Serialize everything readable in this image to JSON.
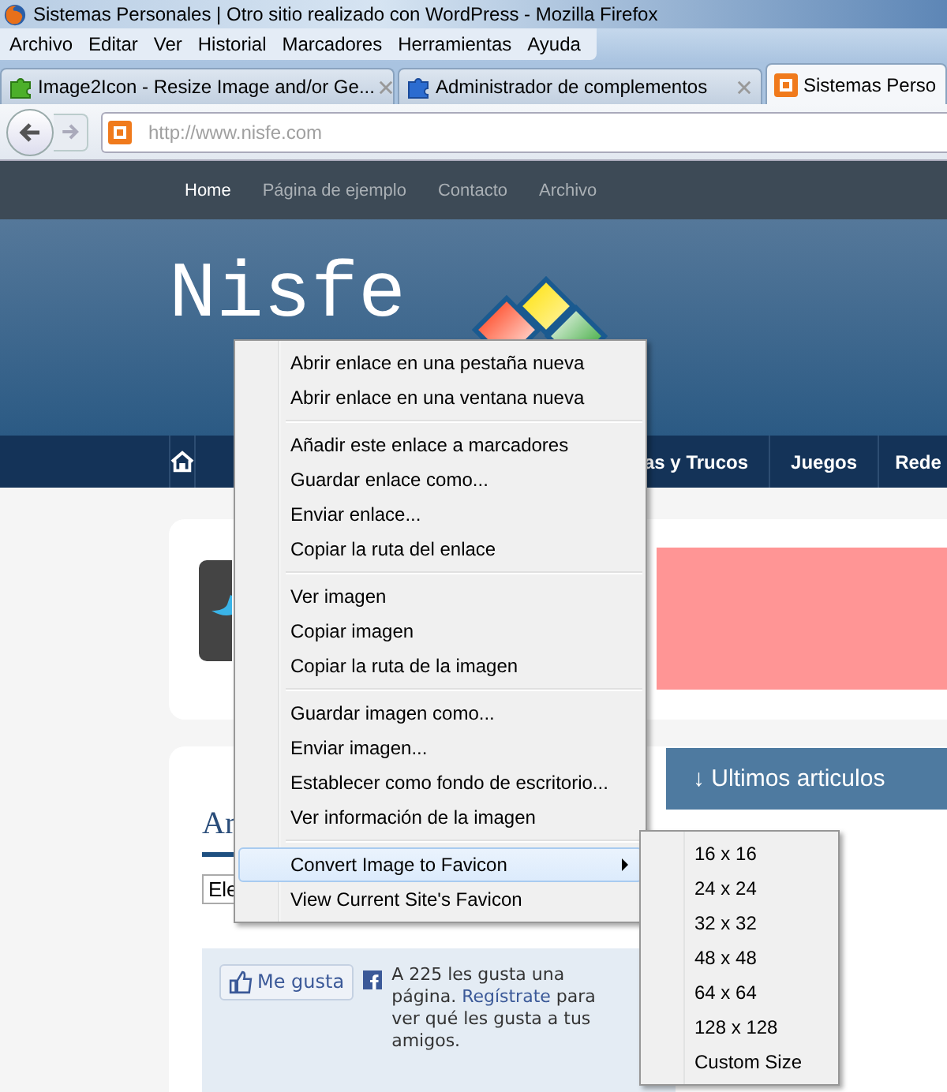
{
  "window": {
    "title": "Sistemas Personales | Otro sitio realizado con WordPress - Mozilla Firefox"
  },
  "menu_bar": [
    "Archivo",
    "Editar",
    "Ver",
    "Historial",
    "Marcadores",
    "Herramientas",
    "Ayuda"
  ],
  "tabs": [
    {
      "title": "Image2Icon - Resize Image and/or Ge...",
      "kind": "addon-green",
      "selected": false,
      "closable": true
    },
    {
      "title": "Administrador de complementos",
      "kind": "addon-blue",
      "selected": false,
      "closable": true
    },
    {
      "title": "Sistemas Perso",
      "kind": "site",
      "selected": true,
      "closable": false
    }
  ],
  "address_bar": {
    "value": "http://www.nisfe.com"
  },
  "site": {
    "top_nav": [
      {
        "label": "Home",
        "selected": true
      },
      {
        "label": "Página de ejemplo",
        "selected": false
      },
      {
        "label": "Contacto",
        "selected": false
      },
      {
        "label": "Archivo",
        "selected": false
      }
    ],
    "logo_text": "Nisfe",
    "main_nav": [
      "as y Trucos",
      "Juegos",
      "Rede"
    ],
    "section_heading": "↓ Ultimos articulos",
    "archive_heading": "Ar",
    "select_value": "Ele",
    "facebook": {
      "like_button": "Me gusta",
      "text_before": "A 225 les gusta una página.",
      "link": "Regístrate",
      "text_after": "para ver qué les gusta a tus amigos."
    }
  },
  "context_menu": {
    "groups": [
      [
        {
          "label": "Abrir enlace en una pestaña nueva",
          "selected": false,
          "has_submenu": false
        },
        {
          "label": "Abrir enlace en una ventana nueva",
          "selected": false,
          "has_submenu": false
        }
      ],
      [
        {
          "label": "Añadir este enlace a marcadores",
          "selected": false,
          "has_submenu": false
        },
        {
          "label": "Guardar enlace como...",
          "selected": false,
          "has_submenu": false
        },
        {
          "label": "Enviar enlace...",
          "selected": false,
          "has_submenu": false
        },
        {
          "label": "Copiar la ruta del enlace",
          "selected": false,
          "has_submenu": false
        }
      ],
      [
        {
          "label": "Ver imagen",
          "selected": false,
          "has_submenu": false
        },
        {
          "label": "Copiar imagen",
          "selected": false,
          "has_submenu": false
        },
        {
          "label": "Copiar la ruta de la imagen",
          "selected": false,
          "has_submenu": false
        }
      ],
      [
        {
          "label": "Guardar imagen como...",
          "selected": false,
          "has_submenu": false
        },
        {
          "label": "Enviar imagen...",
          "selected": false,
          "has_submenu": false
        },
        {
          "label": "Establecer como fondo de escritorio...",
          "selected": false,
          "has_submenu": false
        },
        {
          "label": "Ver información de la imagen",
          "selected": false,
          "has_submenu": false
        }
      ],
      [
        {
          "label": "Convert Image to Favicon",
          "selected": true,
          "has_submenu": true
        },
        {
          "label": "View Current Site's Favicon",
          "selected": false,
          "has_submenu": false
        }
      ]
    ]
  },
  "submenu": {
    "items": [
      "16 x 16",
      "24 x 24",
      "32 x 32",
      "48 x 48",
      "64 x 64",
      "128 x 128",
      "Custom Size"
    ]
  }
}
